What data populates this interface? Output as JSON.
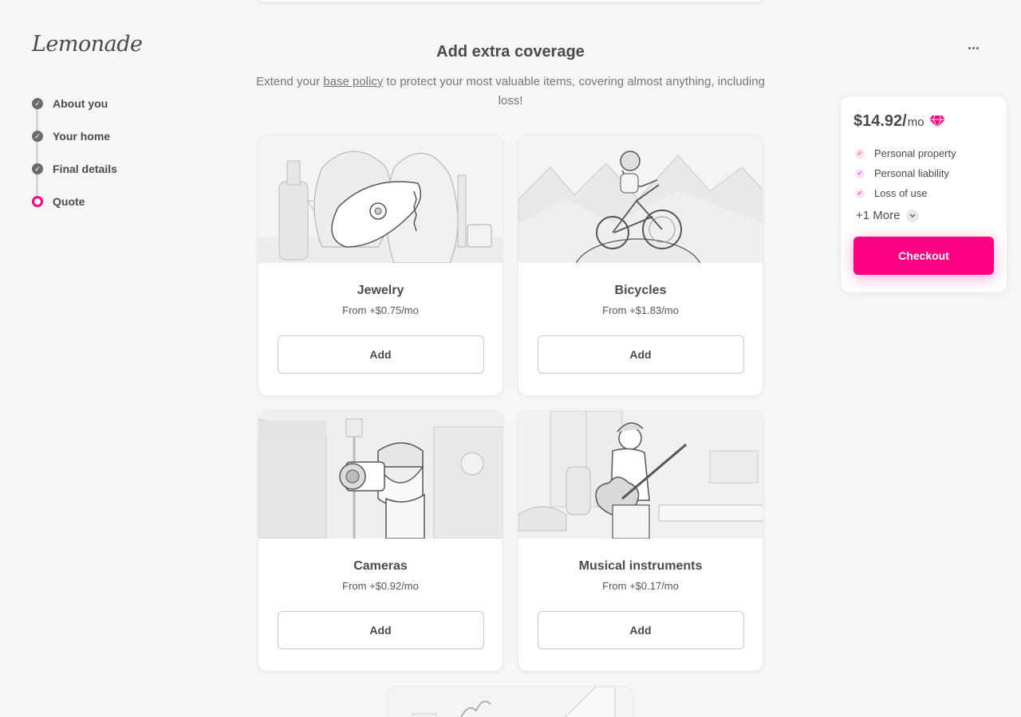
{
  "brand": {
    "logo_text": "Lemonade"
  },
  "steps": [
    {
      "label": "About you",
      "state": "done"
    },
    {
      "label": "Your home",
      "state": "done"
    },
    {
      "label": "Final details",
      "state": "done"
    },
    {
      "label": "Quote",
      "state": "active"
    }
  ],
  "main": {
    "title": "Add extra coverage",
    "subtitle_pre": "Extend your ",
    "subtitle_link": "base policy",
    "subtitle_post": " to protect your most valuable items, covering almost anything, including loss!"
  },
  "cards": [
    {
      "title": "Jewelry",
      "price": "From +$0.75/mo",
      "button": "Add",
      "icon": "jewelry-illustration"
    },
    {
      "title": "Bicycles",
      "price": "From +$1.83/mo",
      "button": "Add",
      "icon": "bicycle-illustration"
    },
    {
      "title": "Cameras",
      "price": "From +$0.92/mo",
      "button": "Add",
      "icon": "camera-illustration"
    },
    {
      "title": "Musical instruments",
      "price": "From +$0.17/mo",
      "button": "Add",
      "icon": "guitar-illustration"
    }
  ],
  "summary": {
    "amount": "$14.92/",
    "per": "mo",
    "items": [
      "Personal property",
      "Personal liability",
      "Loss of use"
    ],
    "more_label": "+1 More",
    "checkout_label": "Checkout"
  },
  "colors": {
    "accent": "#ff0083",
    "background": "#f6f6f6",
    "text": "#4a4a4a"
  }
}
